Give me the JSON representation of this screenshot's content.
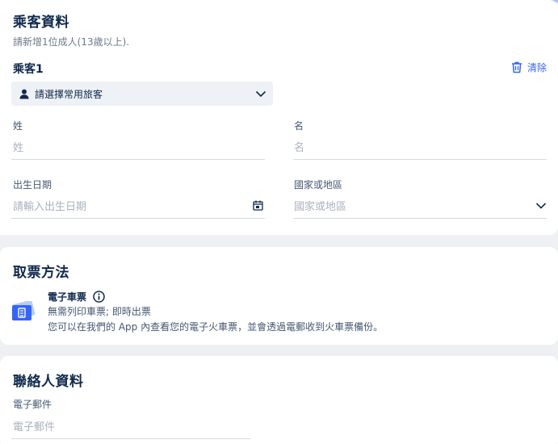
{
  "passenger_section": {
    "title": "乘客資料",
    "note": "請新增1位成人(13歲以上).",
    "passenger_label": "乘客1",
    "clear_label": "清除",
    "frequent_placeholder": "請選擇常用旅客",
    "fields": {
      "surname": {
        "label": "姓",
        "placeholder": "姓"
      },
      "given_name": {
        "label": "名",
        "placeholder": "名"
      },
      "birth_date": {
        "label": "出生日期",
        "placeholder": "請輸入出生日期"
      },
      "country": {
        "label": "國家或地區",
        "placeholder": "國家或地區"
      }
    }
  },
  "ticket_section": {
    "title": "取票方法",
    "option_title": "電子車票",
    "line1": "無需列印車票; 即時出票",
    "line2": "您可以在我們的 App 內查看您的電子火車票，並會透過電郵收到火車票備份。"
  },
  "contact_section": {
    "title": "聯絡人資料",
    "email": {
      "label": "電子郵件",
      "placeholder": "電子郵件"
    }
  },
  "colors": {
    "accent": "#3264ff",
    "heading": "#0f294d",
    "placeholder": "#aab2bf",
    "page_background": "#eef0f4"
  },
  "icons": [
    "trash-icon",
    "user-icon",
    "chevron-down-icon",
    "calendar-icon",
    "info-icon",
    "ticket-icon"
  ]
}
